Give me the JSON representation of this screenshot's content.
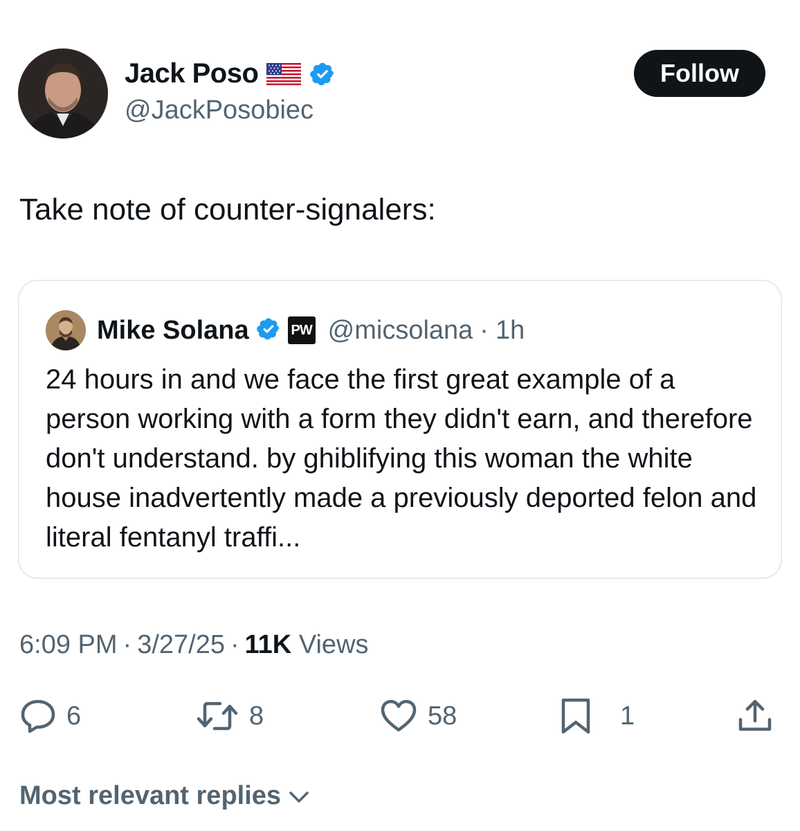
{
  "author": {
    "display_name": "Jack Poso",
    "handle": "@JackPosobiec",
    "flag_icon": "us-flag-icon",
    "verified_icon": "verified-badge-icon",
    "verified_color": "#1d9bf0"
  },
  "follow_button": {
    "label": "Follow"
  },
  "tweet": {
    "text": "Take note of counter-signalers:"
  },
  "quote": {
    "display_name": "Mike Solana",
    "badge_text": "PW",
    "handle": "@micsolana",
    "separator": "·",
    "time": "1h",
    "body": "24 hours in and we face the first great example of a person working with a form they didn't earn, and therefore don't understand. by ghiblifying this woman the white house inadvertently made a previously deported felon and literal fentanyl traffi..."
  },
  "meta": {
    "time": "6:09 PM",
    "sep1": "·",
    "date": "3/27/25",
    "sep2": "·",
    "views_count": "11K",
    "views_label": "Views"
  },
  "actions": {
    "replies": "6",
    "reposts": "8",
    "likes": "58",
    "bookmarks": "1"
  },
  "replies_sort": {
    "label": "Most relevant replies"
  },
  "colors": {
    "text_primary": "#0f1419",
    "text_secondary": "#536471",
    "border": "#e6e9ec",
    "verified": "#1d9bf0"
  }
}
